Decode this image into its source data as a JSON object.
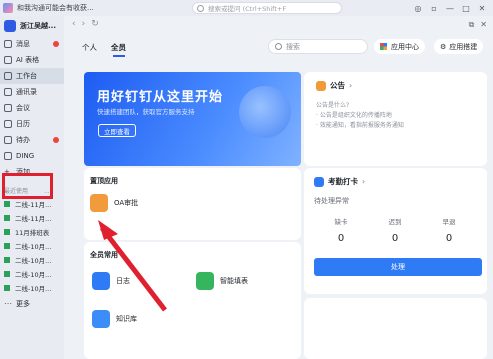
{
  "titlebar": {
    "title": "和我沟通可能会有收获...",
    "search_placeholder": "搜索或提问 (Ctrl+Shift+F"
  },
  "sidebar": {
    "org_name": "浙江吴越...",
    "items": [
      {
        "label": "消息",
        "badge": true
      },
      {
        "label": "AI 表格"
      },
      {
        "label": "工作台"
      },
      {
        "label": "通讯录"
      },
      {
        "label": "会议"
      },
      {
        "label": "日历"
      },
      {
        "label": "待办",
        "badge": true
      },
      {
        "label": "DING"
      },
      {
        "label": "添加"
      }
    ],
    "recent_label": "最近使用",
    "recent_more": "...",
    "chats": [
      "二线-11月...",
      "二线-11月...",
      "11月排班表",
      "二线-10月...",
      "二线-10月...",
      "二线-10月...",
      "二线-10月..."
    ],
    "more_label": "更多"
  },
  "main": {
    "tabs": [
      "个人",
      "全员"
    ],
    "search_placeholder": "搜索",
    "app_center": "应用中心",
    "app_build": "应用搭建",
    "banner": {
      "title": "用好钉钉从这里开始",
      "subtitle": "快速搭建团队，获取官方服务支持",
      "button": "立即查看"
    },
    "notice": {
      "title": "公告",
      "lines": [
        "公告是什么?",
        "· 公告是组织文化的传播阵地",
        "· 效能通知，看指前报服务务通知"
      ]
    },
    "pinned": {
      "title": "置顶应用",
      "apps": [
        "OA审批"
      ]
    },
    "common": {
      "title": "全员常用",
      "apps": [
        "日志",
        "智能填表",
        "知识库"
      ]
    },
    "attendance": {
      "title": "考勤打卡",
      "pending": "待处理异常",
      "stats": [
        {
          "label": "缺卡",
          "value": "0"
        },
        {
          "label": "迟到",
          "value": "0"
        },
        {
          "label": "早退",
          "value": "0"
        }
      ],
      "button": "处理"
    }
  }
}
